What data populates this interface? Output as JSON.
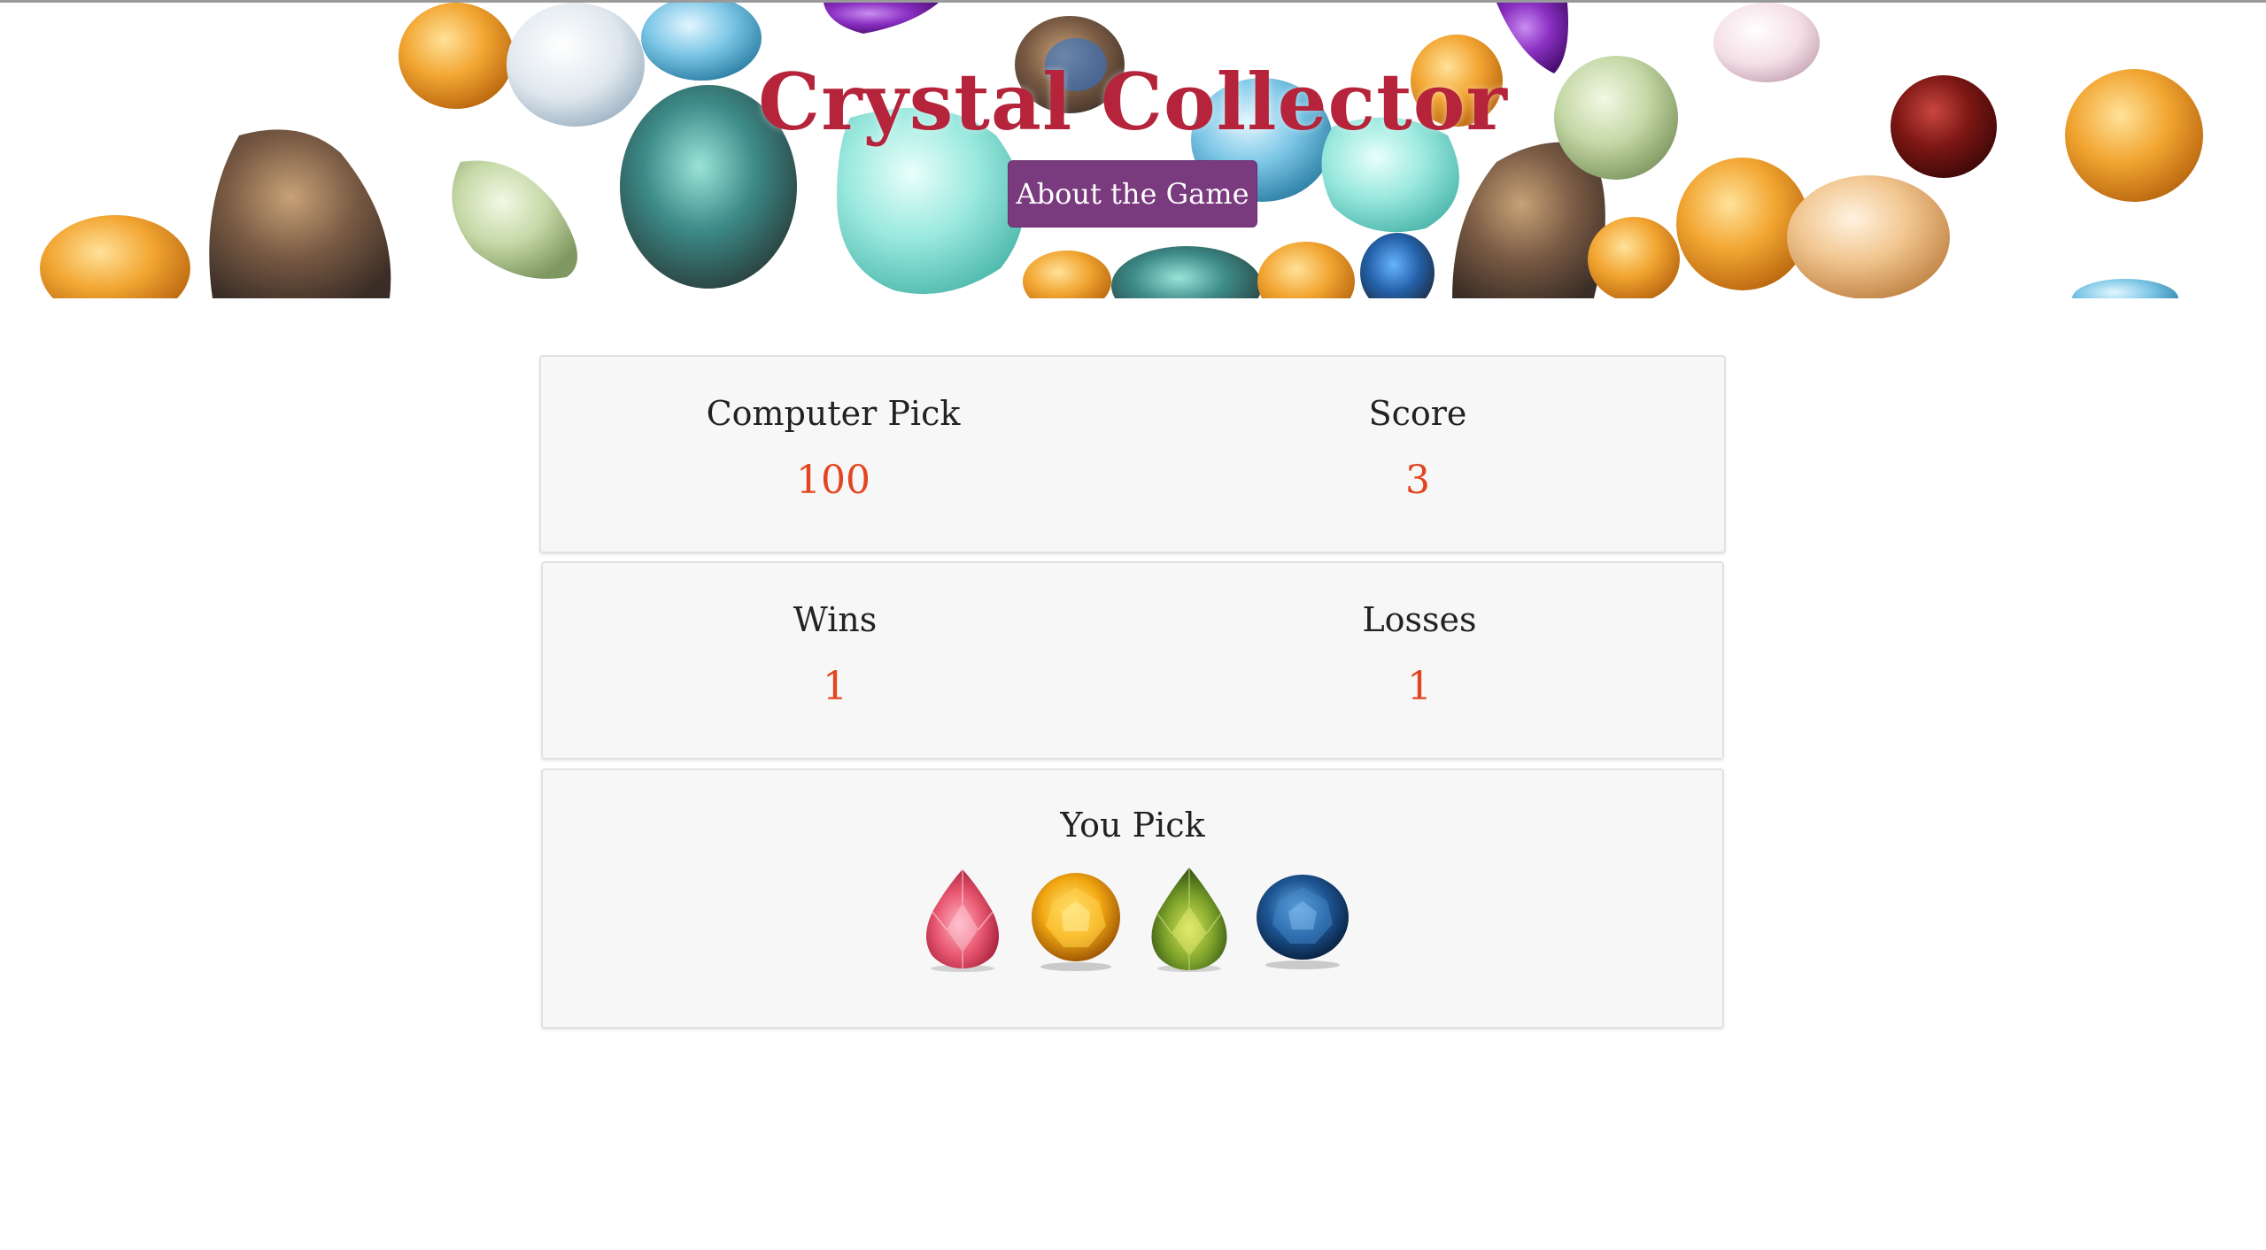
{
  "header": {
    "title": "Crystal Collector",
    "about_button": "About the Game"
  },
  "scoreboard": {
    "computer_pick_label": "Computer Pick",
    "computer_pick_value": "100",
    "score_label": "Score",
    "score_value": "3",
    "wins_label": "Wins",
    "wins_value": "1",
    "losses_label": "Losses",
    "losses_value": "1"
  },
  "picker": {
    "title": "You Pick",
    "crystals": [
      "pink-pear-gem-icon",
      "yellow-round-gem-icon",
      "green-pear-gem-icon",
      "blue-oval-gem-icon"
    ]
  },
  "colors": {
    "title": "#b5243a",
    "button": "#7a3a7e",
    "value": "#e2451f",
    "panel": "#f7f7f7"
  }
}
